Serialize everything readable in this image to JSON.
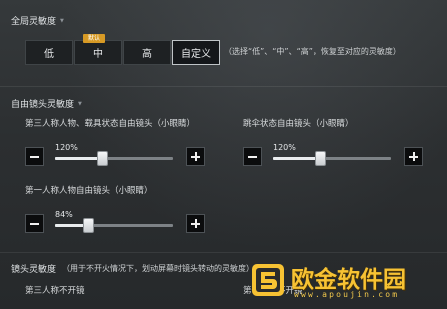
{
  "global_sensitivity": {
    "title": "全局灵敏度",
    "options": [
      "低",
      "中",
      "高",
      "自定义"
    ],
    "selected": "自定义",
    "recommended_badge": "默认",
    "note": "（选择“低”、“中”、“高”，恢复至对应的灵敏度）"
  },
  "free_camera": {
    "title": "自由镜头灵敏度",
    "sliders": [
      {
        "label": "第三人称人物、载具状态自由镜头（小眼睛）",
        "value_label": "120%",
        "value": 0.4
      },
      {
        "label": "跳伞状态自由镜头（小眼睛）",
        "value_label": "120%",
        "value": 0.4
      },
      {
        "label": "第一人称人物自由镜头（小眼睛）",
        "value_label": "84%",
        "value": 0.28
      }
    ]
  },
  "camera_sensitivity": {
    "title": "镜头灵敏度",
    "note": "（用于不开火情况下，划动屏幕时镜头转动的灵敏度）",
    "items": [
      "第三人称不开镜",
      "第一人称不开镜"
    ]
  },
  "watermark": {
    "title": "欧金软件园",
    "url": "www.apoujin.com"
  },
  "colors": {
    "accent": "#d79a25",
    "watermark": "#f7c233"
  }
}
